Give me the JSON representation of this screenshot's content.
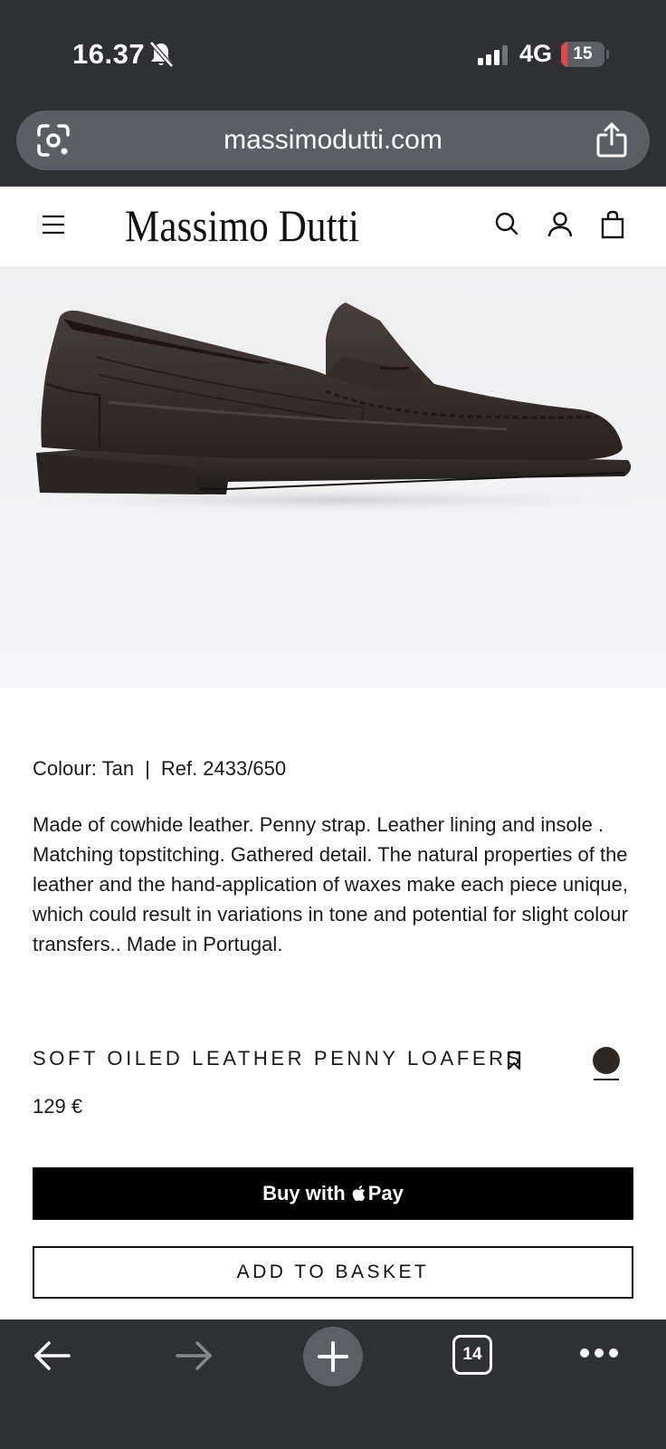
{
  "status_bar": {
    "time": "16.37",
    "network": "4G",
    "battery": "15",
    "battery_level": 0.15
  },
  "browser": {
    "url": "massimodutti.com",
    "tab_count": "14"
  },
  "header": {
    "logo": "Massimo Dutti"
  },
  "product": {
    "colour_label": "Colour: Tan",
    "separator": "|",
    "reference": "Ref. 2433/650",
    "description": "Made of cowhide leather. Penny strap. Leather lining and insole . Matching topstitching. Gathered detail. The natural properties of the leather and the hand-application of waxes make each piece unique, which could result in variations in tone and potential for slight colour transfers.. Made in Portugal.",
    "name": "SOFT OILED LEATHER PENNY LOAFERS",
    "price": "129 €",
    "swatch_color": "#2f2721"
  },
  "actions": {
    "buy_prefix": "Buy with",
    "buy_pay": "Pay",
    "add_to_basket": "ADD TO BASKET"
  },
  "icons": {
    "status": [
      "bell-muted-icon",
      "signal-icon",
      "battery-icon"
    ],
    "browser": [
      "lens-icon",
      "share-icon",
      "back-icon",
      "forward-icon",
      "plus-icon",
      "tabs-icon",
      "more-icon"
    ],
    "header": [
      "menu-icon",
      "search-icon",
      "account-icon",
      "bag-icon"
    ],
    "product": [
      "bookmark-icon",
      "apple-icon"
    ]
  },
  "colors": {
    "browser_chrome": "#2e3034",
    "url_pill": "#5a5e65",
    "battery_low": "#e24848",
    "button_dark": "#000000"
  }
}
